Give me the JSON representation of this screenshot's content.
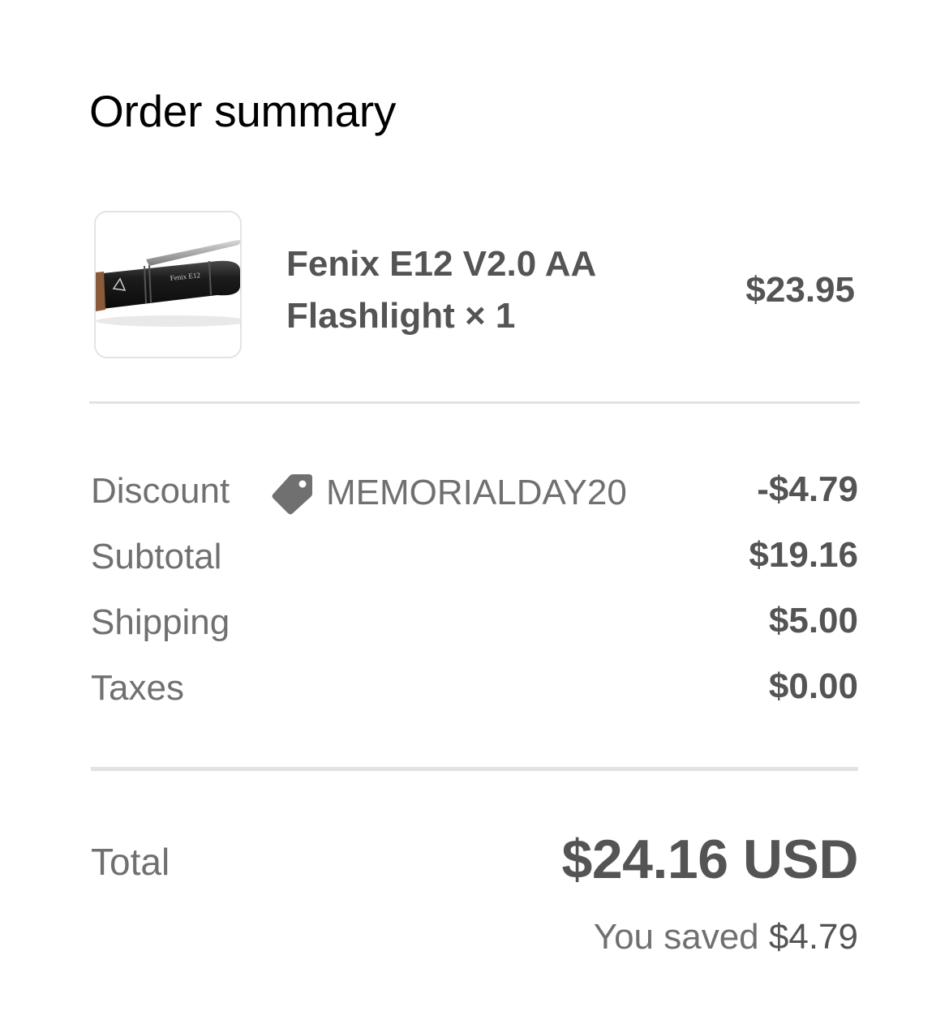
{
  "header": {
    "title": "Order summary"
  },
  "product": {
    "image_icon": "flashlight-thumbnail",
    "image_text": "Fenix E12",
    "name": "Fenix E12 V2.0 AA Flashlight",
    "quantity_text": "× 1",
    "price": "$23.95"
  },
  "lines": {
    "discount": {
      "label": "Discount",
      "code_icon": "tag-icon",
      "code": "MEMORIALDAY20",
      "value": "-$4.79"
    },
    "subtotal": {
      "label": "Subtotal",
      "value": "$19.16"
    },
    "shipping": {
      "label": "Shipping",
      "value": "$5.00"
    },
    "taxes": {
      "label": "Taxes",
      "value": "$0.00"
    }
  },
  "total": {
    "label": "Total",
    "value": "$24.16 USD",
    "saved_prefix": "You saved",
    "saved_amount": "$4.79"
  },
  "colors": {
    "text_dark": "#545454",
    "text_muted": "#707070",
    "divider": "#e2e2e2",
    "title": "#000000"
  }
}
